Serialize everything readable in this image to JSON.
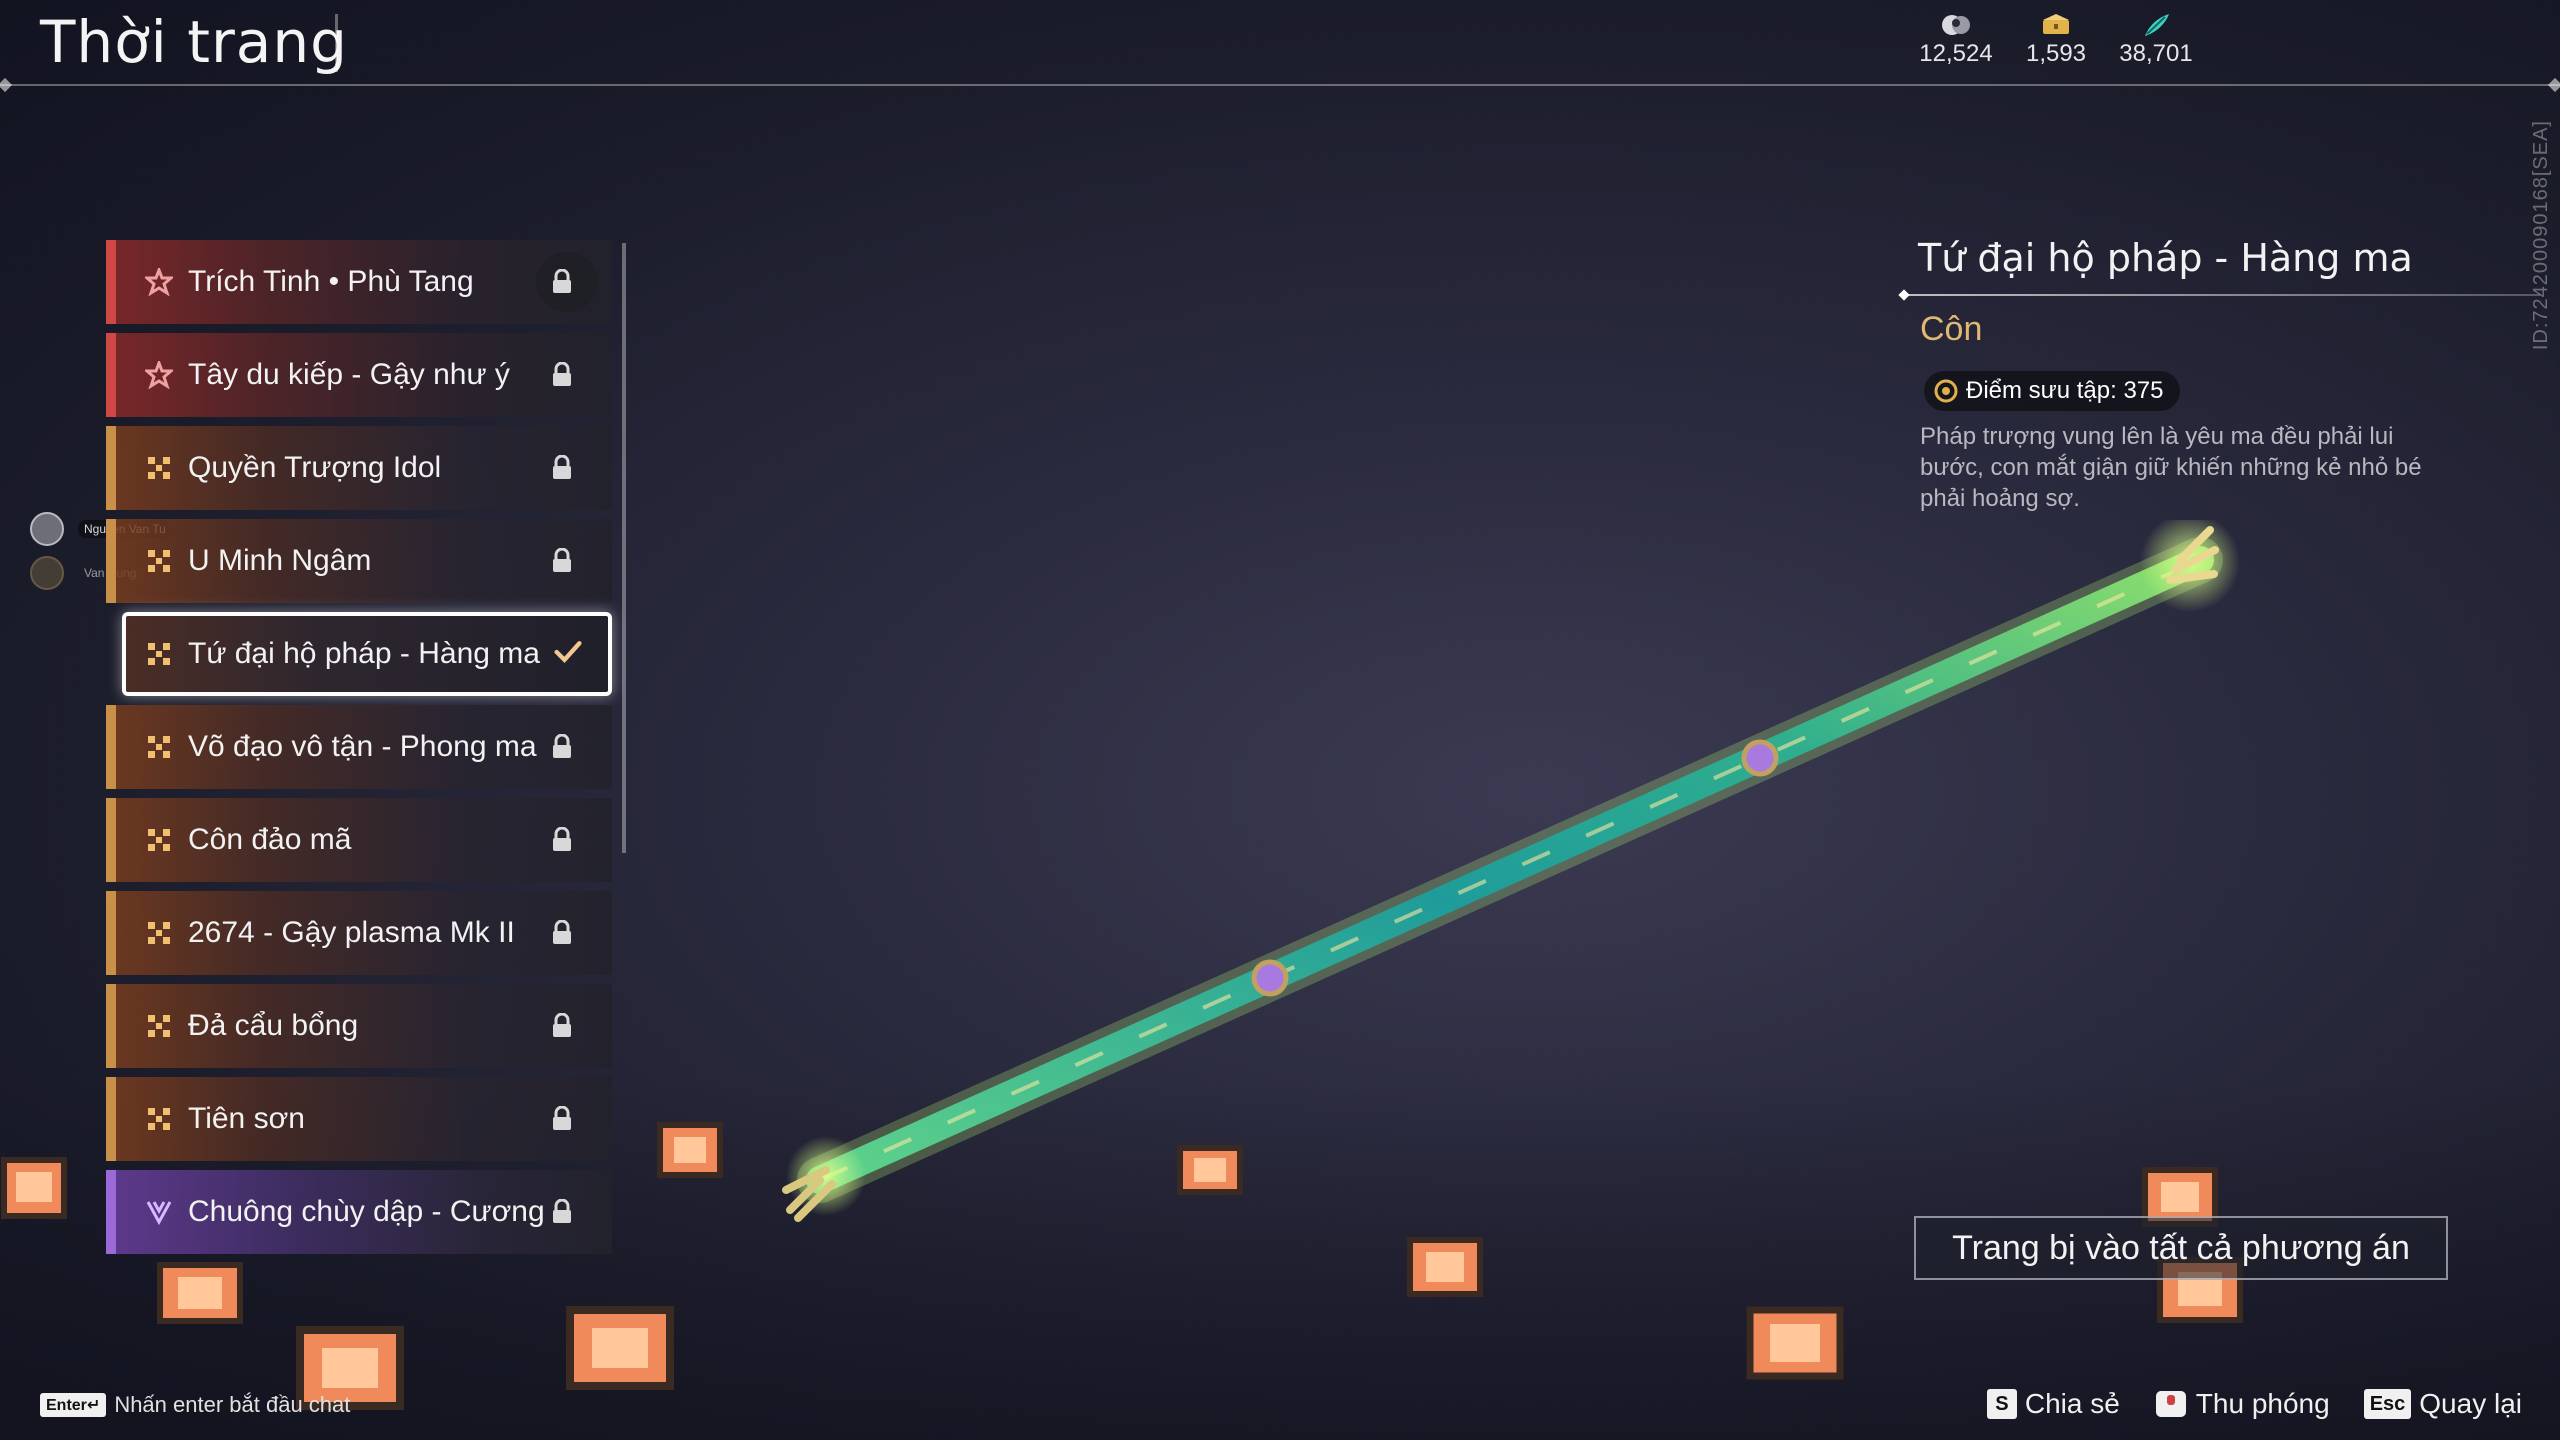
{
  "header": {
    "title": "Thời trang",
    "currencies": [
      {
        "icon": "moon-coin-icon",
        "value": "12,524"
      },
      {
        "icon": "chest-coin-icon",
        "value": "1,593"
      },
      {
        "icon": "feather-coin-icon",
        "value": "38,701"
      }
    ],
    "id_tag": "ID:7242000901​68[SEA]"
  },
  "list": {
    "items": [
      {
        "label": "Trích Tinh • Phù Tang",
        "rarity": "red",
        "state": "locked"
      },
      {
        "label": "Tây du kiếp - Gậy như ý",
        "rarity": "red",
        "state": "locked"
      },
      {
        "label": "Quyền Trượng Idol",
        "rarity": "gold",
        "state": "locked"
      },
      {
        "label": "U Minh Ngâm",
        "rarity": "gold",
        "state": "locked"
      },
      {
        "label": "Tứ đại hộ pháp - Hàng ma",
        "rarity": "gold",
        "state": "equipped"
      },
      {
        "label": "Võ đạo vô tận - Phong ma",
        "rarity": "gold",
        "state": "locked"
      },
      {
        "label": "Côn đảo mã",
        "rarity": "gold",
        "state": "locked"
      },
      {
        "label": "2674 - Gậy plasma Mk II",
        "rarity": "gold",
        "state": "locked"
      },
      {
        "label": "Đả cẩu bổng",
        "rarity": "gold",
        "state": "locked"
      },
      {
        "label": "Tiên sơn",
        "rarity": "gold",
        "state": "locked"
      },
      {
        "label": "Chuông chùy dập - Cương",
        "rarity": "purple",
        "state": "locked"
      }
    ]
  },
  "chat_users": [
    {
      "name": "Nguyen Van Tu"
    },
    {
      "name": "Van Hung"
    }
  ],
  "detail": {
    "title": "Tứ đại hộ pháp - Hàng ma",
    "type": "Côn",
    "collect_points": "Điểm sưu tập: 375",
    "description": "Pháp trượng vung lên là yêu ma đều phải lui bước, con mắt giận giữ khiến những kẻ nhỏ bé phải hoảng sợ.",
    "equip_button": "Trang bị vào tất cả phương án"
  },
  "footer": {
    "chat_key": "Enter↵",
    "chat_hint": "Nhấn enter bắt đầu chat",
    "actions": [
      {
        "key": "S",
        "label": "Chia sẻ"
      },
      {
        "key": "",
        "label": "Thu phóng"
      },
      {
        "key": "Esc",
        "label": "Quay lại"
      }
    ]
  },
  "colors": {
    "rarity_red": "#d04845",
    "rarity_gold": "#c89048",
    "rarity_purple": "#9b6ad8",
    "detail_type": "#e0b872"
  }
}
